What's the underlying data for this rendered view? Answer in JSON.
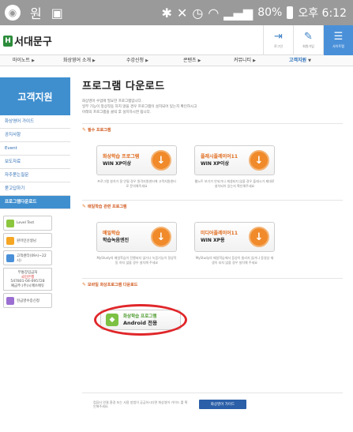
{
  "status_bar": {
    "left_char": "원",
    "battery": "80%",
    "time": "오후 6:12"
  },
  "header": {
    "logo_text": "서대문구",
    "icons": [
      {
        "name": "login",
        "label": "로그인"
      },
      {
        "name": "join",
        "label": "회원가입"
      },
      {
        "name": "sitemap",
        "label": "사이트맵"
      }
    ]
  },
  "nav": [
    {
      "label": "마이노트"
    },
    {
      "label": "화상영어 소개"
    },
    {
      "label": "수강신청"
    },
    {
      "label": "콘텐츠"
    },
    {
      "label": "커뮤니티"
    },
    {
      "label": "고객지원"
    }
  ],
  "sidebar": {
    "title": "고객지원",
    "items": [
      {
        "label": "화상영어 가이드"
      },
      {
        "label": "공지사항"
      },
      {
        "label": "Event"
      },
      {
        "label": "보도자료"
      },
      {
        "label": "자주묻는질문"
      },
      {
        "label": "묻고답하기"
      },
      {
        "label": "프로그램다운로드"
      }
    ],
    "banners": [
      {
        "label": "Level Test",
        "color": "#8cc63f"
      },
      {
        "label": "원어민선생님",
        "color": "#f5a623"
      },
      {
        "label": "고객센터(09시~22시)",
        "color": "#4a90d9"
      }
    ],
    "account": {
      "title": "무통장입금처",
      "bank": "국민은행",
      "number": "547801-04-095728",
      "holder": "예금주:(주)시매쓰에듀"
    },
    "receipt_banner": "현금영수증신청"
  },
  "main": {
    "title": "프로그램 다운로드",
    "intro": [
      "화상영어 수업에 필요한 프로그램입니다.",
      "일부 기능이 정상작동 하지 않을 경우 프로그램이 설치되어 있는지 확인하시고",
      "아래의 프로그램을 클릭 후 설치하시면 됩니다."
    ],
    "sections": [
      {
        "title": "필수 프로그램",
        "cards": [
          {
            "line1": "화상학습 프로그램",
            "line2": "WIN XP이상",
            "desc": "프로그램 설치가 잘 안될 경우 원격지원센터에 고객지원센터로 문의해주세요"
          },
          {
            "line1": "플래시플레이어11",
            "line2": "WIN XP이상",
            "desc": "웹노트 보기가 안되거나 재생되지 않을 경우 플래시가 제대로 설치되어 있는지 확인해주세요"
          }
        ]
      },
      {
        "title": "매일학습 관련 프로그램",
        "cards": [
          {
            "line1": "매일학습",
            "line2": "학습녹음엔진",
            "desc": "MyStudy의 매일학습이 진행되지 않거나 녹음기능이 정상작동 하지 않을 경우 설치해 주세요"
          },
          {
            "line1": "미디어플레이어11",
            "line2": "WIN XP용",
            "desc": "MyStudy의 매일학습에서 음성이 들리지 않거나 동영상 재생이 되지 않을 경우 설치해 주세요"
          }
        ]
      },
      {
        "title": "모바일 화상프로그램 다운로드",
        "android": {
          "line1": "화상학습 프로그램",
          "line2": "Android 전용"
        }
      }
    ],
    "footer": {
      "text": "컴퓨터 연결 환경 또는 사용 방법이 궁금하시다면 화상영어 가이드 를 확인해주세요.",
      "button": "화상영어 가이드"
    }
  }
}
